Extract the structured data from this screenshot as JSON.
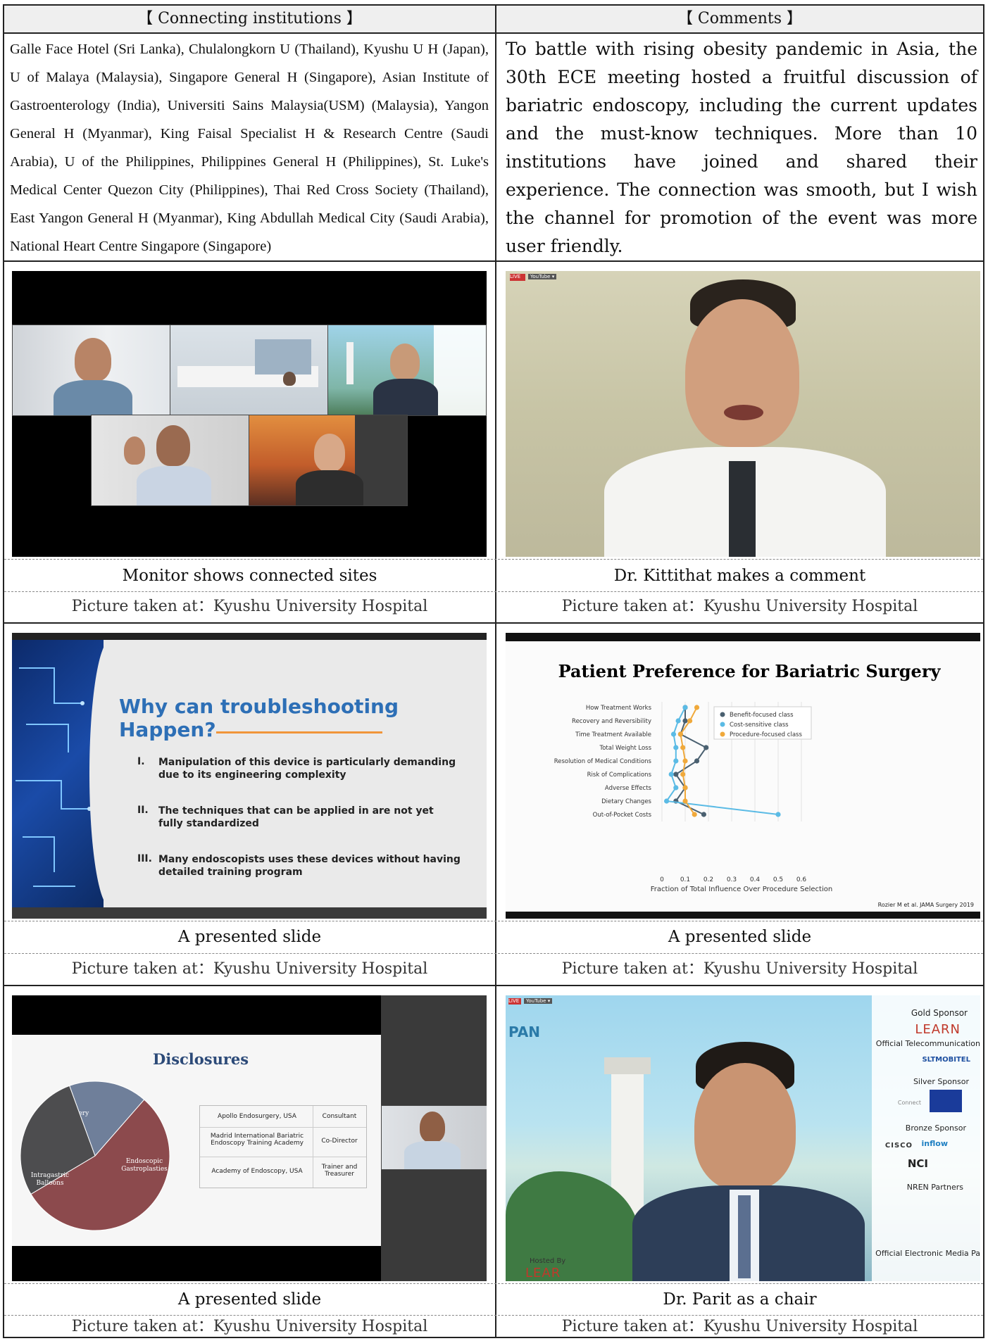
{
  "header": {
    "left": "【 Connecting institutions 】",
    "right": "【 Comments 】"
  },
  "institutions_text": "Galle Face Hotel (Sri Lanka), Chulalongkorn U (Thailand), Kyushu U H (Japan), U of Malaya (Malaysia), Singapore General H (Singapore), Asian Institute of Gastroenterology (India), Universiti Sains Malaysia(USM) (Malaysia), Yangon General H (Myanmar), King Faisal Specialist H & Research Centre (Saudi Arabia), U of the Philippines, Philippines General H (Philippines), St. Luke's Medical Center Quezon City (Philippines), Thai Red Cross Society (Thailand), East Yangon General H (Myanmar), King Abdullah Medical City (Saudi Arabia), National Heart Centre Singapore (Singapore)",
  "comments_text": "To battle with rising obesity pandemic in Asia, the 30th ECE meeting hosted a fruitful discussion of bariatric endoscopy, including the current updates and the must-know techniques. More than 10 institutions have joined and shared their experience. The connection was smooth, but I wish the channel for promotion of the event was more user friendly.",
  "photos": [
    {
      "caption": "Monitor shows connected sites",
      "location": "Picture taken at：Kyushu University Hospital"
    },
    {
      "caption": "Dr. Kittithat makes a comment",
      "location": "Picture taken at：Kyushu University Hospital"
    },
    {
      "caption": "A presented slide",
      "location": "Picture taken at：Kyushu University Hospital"
    },
    {
      "caption": "A presented slide",
      "location": "Picture taken at：Kyushu University Hospital"
    },
    {
      "caption": "A presented slide",
      "location": "Picture taken at：Kyushu University Hospital"
    },
    {
      "caption": "Dr. Parit as a chair",
      "location": "Picture taken at：Kyushu University Hospital"
    }
  ],
  "stream_badges": {
    "live": "LIVE",
    "youtube": "YouTube ▾"
  },
  "slide_troubleshooting": {
    "title": "Why can troubleshooting Happen?",
    "items": [
      {
        "num": "I.",
        "text": "Manipulation of this device is particularly demanding due to its engineering complexity"
      },
      {
        "num": "II.",
        "text": "The techniques that can be applied in are not yet fully standardized"
      },
      {
        "num": "III.",
        "text": "Many endoscopists uses these devices without having detailed training program"
      }
    ]
  },
  "chart_data": {
    "type": "line",
    "title": "Patient Preference for Bariatric Surgery",
    "xlabel": "Fraction of Total Influence Over Procedure Selection",
    "xlim": [
      0,
      0.6
    ],
    "xticks": [
      "0",
      "0.1",
      "0.2",
      "0.3",
      "0.4",
      "0.5",
      "0.6"
    ],
    "categories": [
      "How Treatment Works",
      "Recovery and Reversibility",
      "Time Treatment Available",
      "Total Weight Loss",
      "Resolution of Medical Conditions",
      "Risk of Complications",
      "Adverse Effects",
      "Dietary Changes",
      "Out-of-Pocket Costs"
    ],
    "series": [
      {
        "name": "Benefit-focused class",
        "color": "#4a6070",
        "values": [
          0.1,
          0.1,
          0.08,
          0.19,
          0.15,
          0.06,
          0.1,
          0.06,
          0.18
        ]
      },
      {
        "name": "Cost-sensitive class",
        "color": "#5bbbe5",
        "values": [
          0.1,
          0.07,
          0.05,
          0.06,
          0.06,
          0.04,
          0.06,
          0.02,
          0.5
        ]
      },
      {
        "name": "Procedure-focused class",
        "color": "#f0a93b",
        "values": [
          0.15,
          0.12,
          0.08,
          0.09,
          0.1,
          0.09,
          0.1,
          0.1,
          0.14
        ]
      }
    ],
    "grid": true,
    "legend": "top-right",
    "source": "Rozier M et al. JAMA Surgery 2019"
  },
  "slide_disclosures": {
    "title": "Disclosures",
    "pie": [
      {
        "label": "Bariatric surgery Revision",
        "color": "#6f7f9a",
        "value": 17
      },
      {
        "label": "Endoscopic Gastroplasties",
        "color": "#8c4a4d",
        "value": 55
      },
      {
        "label": "Intragastric Balloons",
        "color": "#4d4d4f",
        "value": 28
      }
    ],
    "table": [
      {
        "org": "Apollo Endosurgery, USA",
        "role": "Consultant"
      },
      {
        "org": "Madrid International Bariatric Endoscopy Training Academy",
        "role": "Co-Director"
      },
      {
        "org": "Academy of Endoscopy, USA",
        "role": "Trainer and Treasurer"
      }
    ]
  },
  "sponsor_panel": {
    "gold": "Gold Sponsor",
    "learn": "LEARN",
    "official_telecom": "Official Telecommunication",
    "sltmobitel": "SLTMOBITEL",
    "silver": "Silver Sponsor",
    "connect": "Connect",
    "bronze": "Bronze Sponsor",
    "cisco": "CISCO",
    "inflow": "inflow",
    "nci": "NCI",
    "nren": "NREN Partners",
    "media": "Official Electronic Media Pa",
    "hosted_by": "Hosted By",
    "hosted_learn": "LEAR"
  }
}
